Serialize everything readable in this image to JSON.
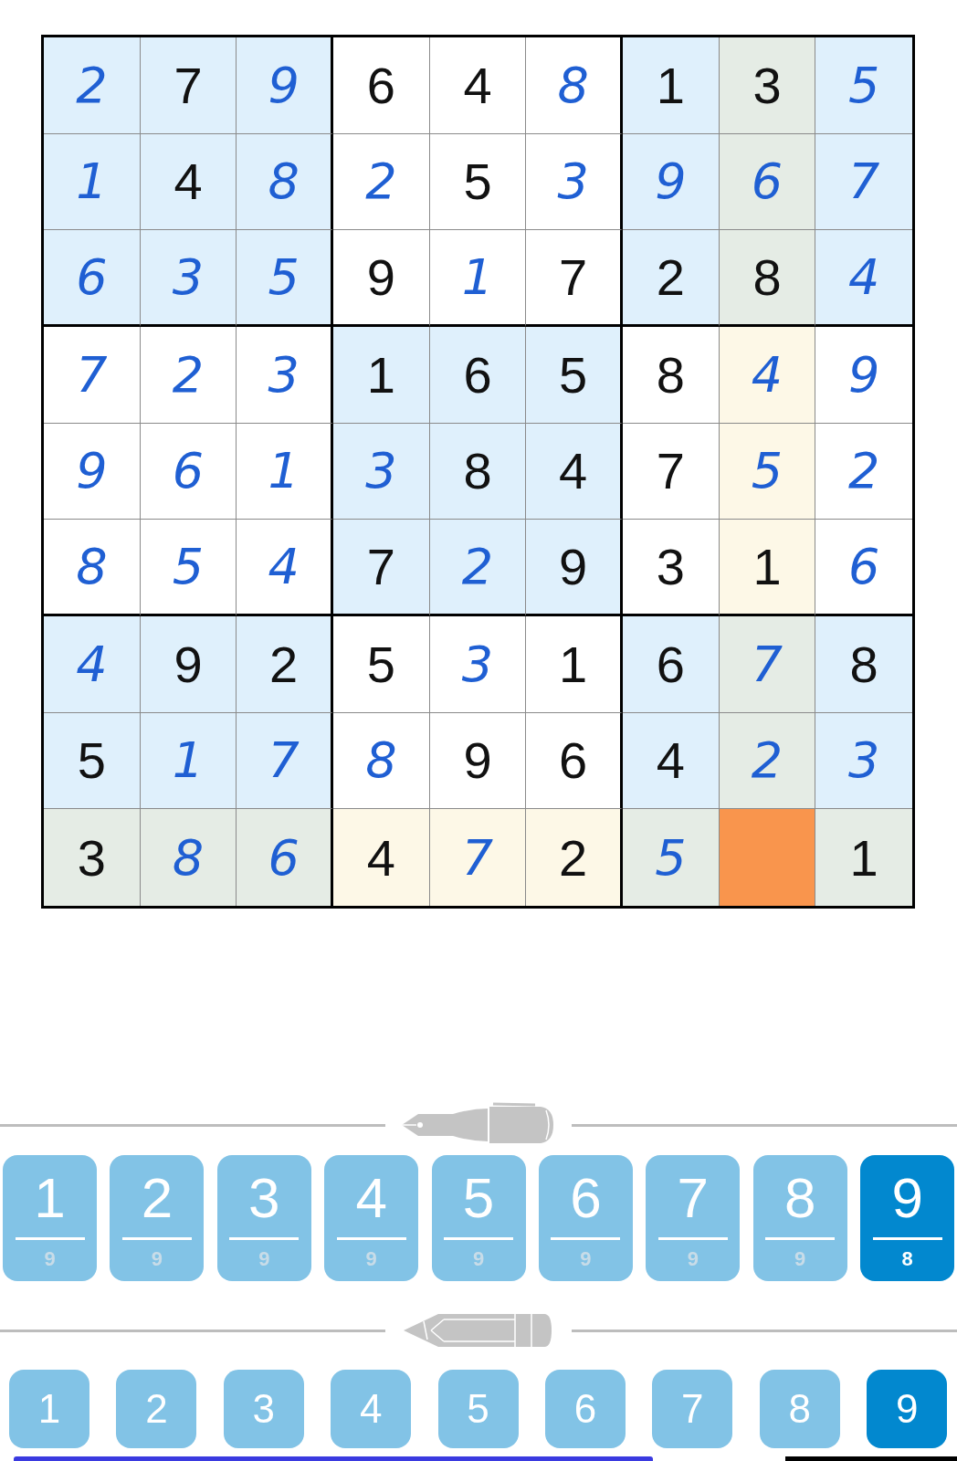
{
  "grid": {
    "rows": [
      [
        {
          "value": "2",
          "kind": "entered",
          "color": "#dff0fc",
          "selected": false
        },
        {
          "value": "7",
          "kind": "given",
          "color": "#dff0fc",
          "selected": false
        },
        {
          "value": "9",
          "kind": "entered",
          "color": "#dff0fc",
          "selected": false
        },
        {
          "value": "6",
          "kind": "given",
          "color": "#ffffff",
          "selected": false
        },
        {
          "value": "4",
          "kind": "given",
          "color": "#ffffff",
          "selected": false
        },
        {
          "value": "8",
          "kind": "entered",
          "color": "#ffffff",
          "selected": false
        },
        {
          "value": "1",
          "kind": "given",
          "color": "#dff0fc",
          "selected": false
        },
        {
          "value": "3",
          "kind": "given",
          "color": "#e5ece5",
          "selected": false
        },
        {
          "value": "5",
          "kind": "entered",
          "color": "#dff0fc",
          "selected": false
        }
      ],
      [
        {
          "value": "1",
          "kind": "entered",
          "color": "#dff0fc",
          "selected": false
        },
        {
          "value": "4",
          "kind": "given",
          "color": "#dff0fc",
          "selected": false
        },
        {
          "value": "8",
          "kind": "entered",
          "color": "#dff0fc",
          "selected": false
        },
        {
          "value": "2",
          "kind": "entered",
          "color": "#ffffff",
          "selected": false
        },
        {
          "value": "5",
          "kind": "given",
          "color": "#ffffff",
          "selected": false
        },
        {
          "value": "3",
          "kind": "entered",
          "color": "#ffffff",
          "selected": false
        },
        {
          "value": "9",
          "kind": "entered",
          "color": "#dff0fc",
          "selected": false
        },
        {
          "value": "6",
          "kind": "entered",
          "color": "#e5ece5",
          "selected": false
        },
        {
          "value": "7",
          "kind": "entered",
          "color": "#dff0fc",
          "selected": false
        }
      ],
      [
        {
          "value": "6",
          "kind": "entered",
          "color": "#dff0fc",
          "selected": false
        },
        {
          "value": "3",
          "kind": "entered",
          "color": "#dff0fc",
          "selected": false
        },
        {
          "value": "5",
          "kind": "entered",
          "color": "#dff0fc",
          "selected": false
        },
        {
          "value": "9",
          "kind": "given",
          "color": "#ffffff",
          "selected": false
        },
        {
          "value": "1",
          "kind": "entered",
          "color": "#ffffff",
          "selected": false
        },
        {
          "value": "7",
          "kind": "given",
          "color": "#ffffff",
          "selected": false
        },
        {
          "value": "2",
          "kind": "given",
          "color": "#dff0fc",
          "selected": false
        },
        {
          "value": "8",
          "kind": "given",
          "color": "#e5ece5",
          "selected": false
        },
        {
          "value": "4",
          "kind": "entered",
          "color": "#dff0fc",
          "selected": false
        }
      ],
      [
        {
          "value": "7",
          "kind": "entered",
          "color": "#ffffff",
          "selected": false
        },
        {
          "value": "2",
          "kind": "entered",
          "color": "#ffffff",
          "selected": false
        },
        {
          "value": "3",
          "kind": "entered",
          "color": "#ffffff",
          "selected": false
        },
        {
          "value": "1",
          "kind": "given",
          "color": "#dff0fc",
          "selected": false
        },
        {
          "value": "6",
          "kind": "given",
          "color": "#dff0fc",
          "selected": false
        },
        {
          "value": "5",
          "kind": "given",
          "color": "#dff0fc",
          "selected": false
        },
        {
          "value": "8",
          "kind": "given",
          "color": "#ffffff",
          "selected": false
        },
        {
          "value": "4",
          "kind": "entered",
          "color": "#fdf8e7",
          "selected": false
        },
        {
          "value": "9",
          "kind": "entered",
          "color": "#ffffff",
          "selected": false
        }
      ],
      [
        {
          "value": "9",
          "kind": "entered",
          "color": "#ffffff",
          "selected": false
        },
        {
          "value": "6",
          "kind": "entered",
          "color": "#ffffff",
          "selected": false
        },
        {
          "value": "1",
          "kind": "entered",
          "color": "#ffffff",
          "selected": false
        },
        {
          "value": "3",
          "kind": "entered",
          "color": "#dff0fc",
          "selected": false
        },
        {
          "value": "8",
          "kind": "given",
          "color": "#dff0fc",
          "selected": false
        },
        {
          "value": "4",
          "kind": "given",
          "color": "#dff0fc",
          "selected": false
        },
        {
          "value": "7",
          "kind": "given",
          "color": "#ffffff",
          "selected": false
        },
        {
          "value": "5",
          "kind": "entered",
          "color": "#fdf8e7",
          "selected": false
        },
        {
          "value": "2",
          "kind": "entered",
          "color": "#ffffff",
          "selected": false
        }
      ],
      [
        {
          "value": "8",
          "kind": "entered",
          "color": "#ffffff",
          "selected": false
        },
        {
          "value": "5",
          "kind": "entered",
          "color": "#ffffff",
          "selected": false
        },
        {
          "value": "4",
          "kind": "entered",
          "color": "#ffffff",
          "selected": false
        },
        {
          "value": "7",
          "kind": "given",
          "color": "#dff0fc",
          "selected": false
        },
        {
          "value": "2",
          "kind": "entered",
          "color": "#dff0fc",
          "selected": false
        },
        {
          "value": "9",
          "kind": "given",
          "color": "#dff0fc",
          "selected": false
        },
        {
          "value": "3",
          "kind": "given",
          "color": "#ffffff",
          "selected": false
        },
        {
          "value": "1",
          "kind": "given",
          "color": "#fdf8e7",
          "selected": false
        },
        {
          "value": "6",
          "kind": "entered",
          "color": "#ffffff",
          "selected": false
        }
      ],
      [
        {
          "value": "4",
          "kind": "entered",
          "color": "#dff0fc",
          "selected": false
        },
        {
          "value": "9",
          "kind": "given",
          "color": "#dff0fc",
          "selected": false
        },
        {
          "value": "2",
          "kind": "given",
          "color": "#dff0fc",
          "selected": false
        },
        {
          "value": "5",
          "kind": "given",
          "color": "#ffffff",
          "selected": false
        },
        {
          "value": "3",
          "kind": "entered",
          "color": "#ffffff",
          "selected": false
        },
        {
          "value": "1",
          "kind": "given",
          "color": "#ffffff",
          "selected": false
        },
        {
          "value": "6",
          "kind": "given",
          "color": "#dff0fc",
          "selected": false
        },
        {
          "value": "7",
          "kind": "entered",
          "color": "#e5ece5",
          "selected": false
        },
        {
          "value": "8",
          "kind": "given",
          "color": "#dff0fc",
          "selected": false
        }
      ],
      [
        {
          "value": "5",
          "kind": "given",
          "color": "#dff0fc",
          "selected": false
        },
        {
          "value": "1",
          "kind": "entered",
          "color": "#dff0fc",
          "selected": false
        },
        {
          "value": "7",
          "kind": "entered",
          "color": "#dff0fc",
          "selected": false
        },
        {
          "value": "8",
          "kind": "entered",
          "color": "#ffffff",
          "selected": false
        },
        {
          "value": "9",
          "kind": "given",
          "color": "#ffffff",
          "selected": false
        },
        {
          "value": "6",
          "kind": "given",
          "color": "#ffffff",
          "selected": false
        },
        {
          "value": "4",
          "kind": "given",
          "color": "#dff0fc",
          "selected": false
        },
        {
          "value": "2",
          "kind": "entered",
          "color": "#e5ece5",
          "selected": false
        },
        {
          "value": "3",
          "kind": "entered",
          "color": "#dff0fc",
          "selected": false
        }
      ],
      [
        {
          "value": "3",
          "kind": "given",
          "color": "#e5ece5",
          "selected": false
        },
        {
          "value": "8",
          "kind": "entered",
          "color": "#e5ece5",
          "selected": false
        },
        {
          "value": "6",
          "kind": "entered",
          "color": "#e5ece5",
          "selected": false
        },
        {
          "value": "4",
          "kind": "given",
          "color": "#fdf8e7",
          "selected": false
        },
        {
          "value": "7",
          "kind": "entered",
          "color": "#fdf8e7",
          "selected": false
        },
        {
          "value": "2",
          "kind": "given",
          "color": "#fdf8e7",
          "selected": false
        },
        {
          "value": "5",
          "kind": "entered",
          "color": "#e5ece5",
          "selected": false
        },
        {
          "kind": "empty",
          "selected": true
        },
        {
          "value": "1",
          "kind": "given",
          "color": "#e5ece5",
          "selected": false
        }
      ]
    ]
  },
  "pen_pad": [
    {
      "digit": "1",
      "count": "9",
      "selected": false
    },
    {
      "digit": "2",
      "count": "9",
      "selected": false
    },
    {
      "digit": "3",
      "count": "9",
      "selected": false
    },
    {
      "digit": "4",
      "count": "9",
      "selected": false
    },
    {
      "digit": "5",
      "count": "9",
      "selected": false
    },
    {
      "digit": "6",
      "count": "9",
      "selected": false
    },
    {
      "digit": "7",
      "count": "9",
      "selected": false
    },
    {
      "digit": "8",
      "count": "9",
      "selected": false
    },
    {
      "digit": "9",
      "count": "8",
      "selected": true
    }
  ],
  "pencil_pad": [
    {
      "digit": "1",
      "selected": false
    },
    {
      "digit": "2",
      "selected": false
    },
    {
      "digit": "3",
      "selected": false
    },
    {
      "digit": "4",
      "selected": false
    },
    {
      "digit": "5",
      "selected": false
    },
    {
      "digit": "6",
      "selected": false
    },
    {
      "digit": "7",
      "selected": false
    },
    {
      "digit": "8",
      "selected": false
    },
    {
      "digit": "9",
      "selected": true
    }
  ]
}
